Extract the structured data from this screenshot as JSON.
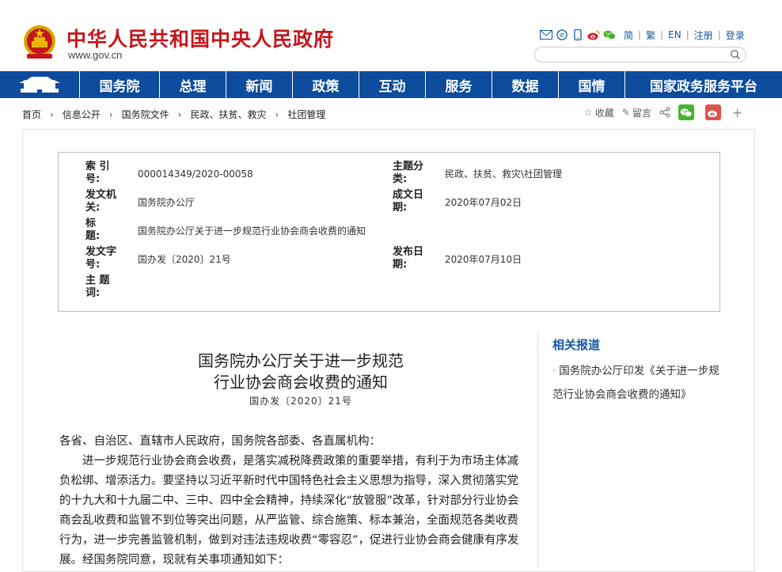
{
  "header": {
    "site_name": "中华人民共和国中央人民政府",
    "site_url": "www.gov.cn",
    "links": [
      "简",
      "繁",
      "EN",
      "注册",
      "登录"
    ],
    "icons": [
      "mail-icon",
      "chat-icon",
      "mobile-icon",
      "weibo-icon",
      "wechat-icon"
    ]
  },
  "nav": {
    "items": [
      "国务院",
      "总理",
      "新闻",
      "政策",
      "互动",
      "服务",
      "数据",
      "国情",
      "国家政务服务平台"
    ]
  },
  "breadcrumb": [
    "首页",
    "信息公开",
    "国务院文件",
    "民政、扶贫、救灾",
    "社团管理"
  ],
  "tools": {
    "favorite": "收藏",
    "comment": "留言",
    "plus": "+"
  },
  "info": {
    "index_label": "索 引 号:",
    "index_value": "000014349/2020-00058",
    "topic_label": "主题分类:",
    "topic_value": "民政、扶贫、救灾\\社团管理",
    "issuer_label": "发文机关:",
    "issuer_value": "国务院办公厅",
    "date_label": "成文日期:",
    "date_value": "2020年07月02日",
    "title_label": "标　　题:",
    "title_value": "国务院办公厅关于进一步规范行业协会商会收费的通知",
    "docno_label": "发文字号:",
    "docno_value": "国办发〔2020〕21号",
    "pub_label": "发布日期:",
    "pub_value": "2020年07月10日",
    "keyword_label": "主 题 词:",
    "keyword_value": ""
  },
  "document": {
    "title_line1": "国务院办公厅关于进一步规范",
    "title_line2": "行业协会商会收费的通知",
    "number": "国办发〔2020〕21号",
    "salutation": "各省、自治区、直辖市人民政府，国务院各部委、各直属机构：",
    "paragraph1": "进一步规范行业协会商会收费，是落实减税降费政策的重要举措，有利于为市场主体减负松绑、增添活力。要坚持以习近平新时代中国特色社会主义思想为指导，深入贯彻落实党的十九大和十九届二中、三中、四中全会精神，持续深化“放管服”改革，针对部分行业协会商会乱收费和监管不到位等突出问题，从严监管、综合施策、标本兼治，全面规范各类收费行为，进一步完善监管机制，做到对违法违规收费“零容忍”，促进行业协会商会健康有序发展。经国务院同意，现就有关事项通知如下："
  },
  "related": {
    "title": "相关报道",
    "item": "国务院办公厅印发《关于进一步规范行业协会商会收费的通知》"
  },
  "colors": {
    "brand_red": "#c4161c",
    "nav_blue": "#0d4b9c",
    "link_blue": "#1557a6"
  }
}
